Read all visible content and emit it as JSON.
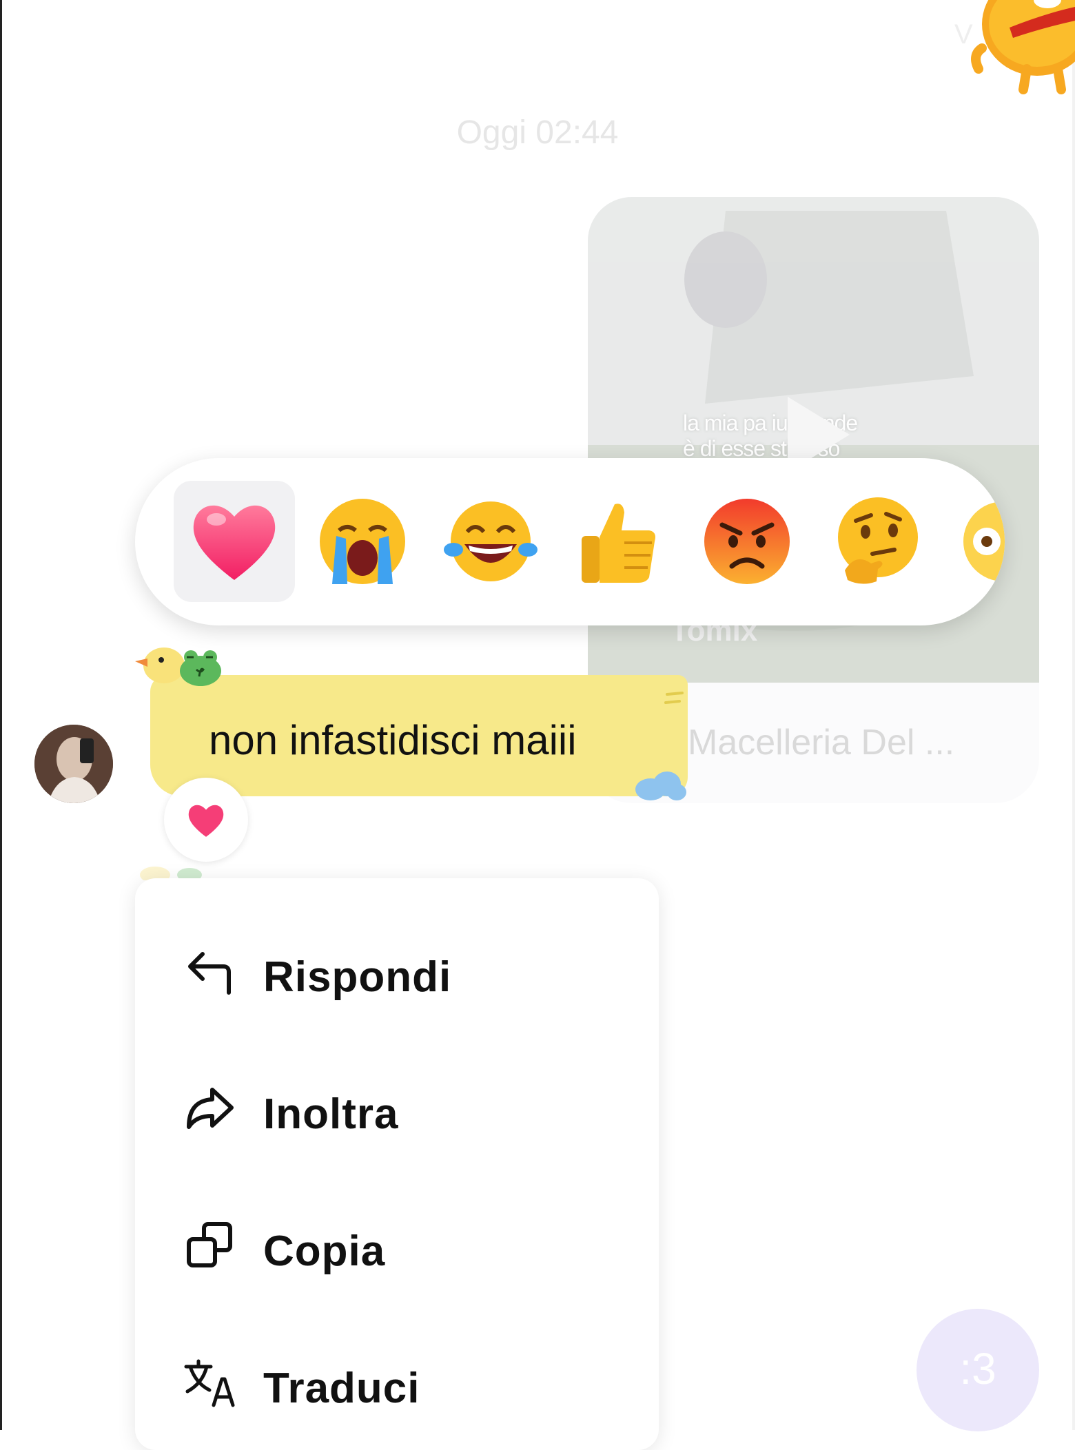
{
  "header": {
    "timestamp": "Oggi 02:44",
    "top_initial": "V"
  },
  "shared_video": {
    "caption_line1": "la mia pa    iu grande",
    "caption_line2": "è di esse       stidioso",
    "watermark": "Tomix",
    "title": "Macelleria Del ..."
  },
  "reaction_bar": {
    "reactions": [
      "heart",
      "loudly-crying-face",
      "face-with-tears-of-joy",
      "thumbs-up",
      "angry-face",
      "thinking-face",
      "partial-face"
    ],
    "selected": "heart"
  },
  "message": {
    "text": "non infastidisci maiii",
    "reaction": "heart",
    "bubble_color": "#f7e98a"
  },
  "context_menu": {
    "items": [
      {
        "label": "Rispondi",
        "icon": "reply-icon"
      },
      {
        "label": "Inoltra",
        "icon": "forward-icon"
      },
      {
        "label": "Copia",
        "icon": "copy-icon"
      },
      {
        "label": "Traduci",
        "icon": "translate-icon"
      }
    ]
  },
  "fab": {
    "label": ":3"
  },
  "colors": {
    "accent_heart": "#ff3d7a",
    "menu_text": "#111111",
    "fab_bg": "#ece8fb"
  }
}
